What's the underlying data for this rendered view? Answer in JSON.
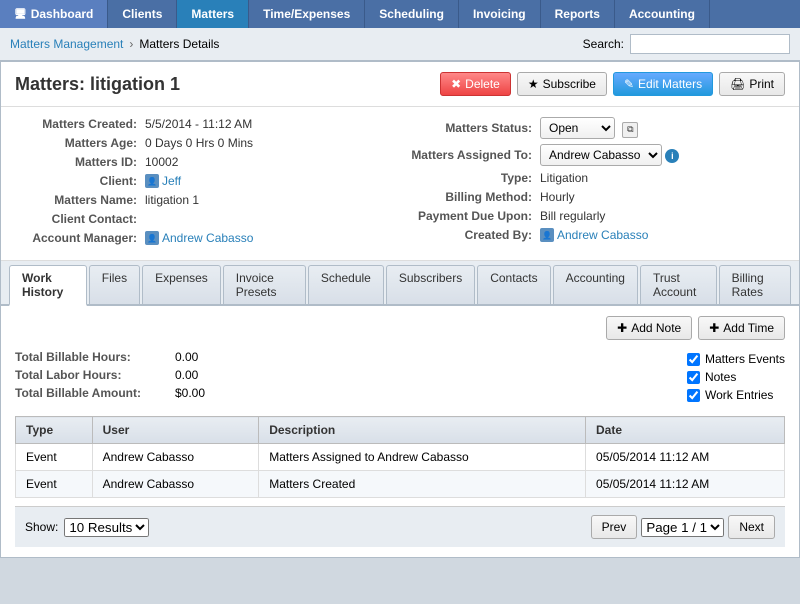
{
  "nav": {
    "items": [
      {
        "label": "Dashboard",
        "key": "dashboard",
        "active": false
      },
      {
        "label": "Clients",
        "key": "clients",
        "active": false
      },
      {
        "label": "Matters",
        "key": "matters",
        "active": true
      },
      {
        "label": "Time/Expenses",
        "key": "time",
        "active": false
      },
      {
        "label": "Scheduling",
        "key": "scheduling",
        "active": false
      },
      {
        "label": "Invoicing",
        "key": "invoicing",
        "active": false
      },
      {
        "label": "Reports",
        "key": "reports",
        "active": false
      },
      {
        "label": "Accounting",
        "key": "accounting",
        "active": false
      }
    ]
  },
  "breadcrumb": {
    "parent": "Matters Management",
    "current": "Matters Details"
  },
  "search": {
    "label": "Search:",
    "placeholder": ""
  },
  "matter": {
    "title": "Matters: litigation 1",
    "actions": {
      "delete": "Delete",
      "subscribe": "Subscribe",
      "edit": "Edit Matters",
      "print": "Print"
    },
    "fields": {
      "created_label": "Matters Created:",
      "created_value": "5/5/2014 - 11:12 AM",
      "age_label": "Matters Age:",
      "age_value": "0 Days 0 Hrs 0 Mins",
      "id_label": "Matters ID:",
      "id_value": "10002",
      "client_label": "Client:",
      "client_value": "Jeff",
      "name_label": "Matters Name:",
      "name_value": "litigation 1",
      "contact_label": "Client Contact:",
      "contact_value": "",
      "manager_label": "Account Manager:",
      "manager_value": "Andrew Cabasso",
      "status_label": "Matters Status:",
      "status_value": "Open",
      "assigned_label": "Matters Assigned To:",
      "assigned_value": "Andrew Cabasso",
      "type_label": "Type:",
      "type_value": "Litigation",
      "billing_label": "Billing Method:",
      "billing_value": "Hourly",
      "payment_label": "Payment Due Upon:",
      "payment_value": "Bill regularly",
      "created_by_label": "Created By:",
      "created_by_value": "Andrew Cabasso"
    }
  },
  "tabs": [
    {
      "label": "Work History",
      "key": "work-history",
      "active": true
    },
    {
      "label": "Files",
      "key": "files",
      "active": false
    },
    {
      "label": "Expenses",
      "key": "expenses",
      "active": false
    },
    {
      "label": "Invoice Presets",
      "key": "invoice-presets",
      "active": false
    },
    {
      "label": "Schedule",
      "key": "schedule",
      "active": false
    },
    {
      "label": "Subscribers",
      "key": "subscribers",
      "active": false
    },
    {
      "label": "Contacts",
      "key": "contacts",
      "active": false
    },
    {
      "label": "Accounting",
      "key": "accounting",
      "active": false
    },
    {
      "label": "Trust Account",
      "key": "trust-account",
      "active": false
    },
    {
      "label": "Billing Rates",
      "key": "billing-rates",
      "active": false
    }
  ],
  "tab_actions": {
    "add_note": "Add Note",
    "add_time": "Add Time"
  },
  "stats": {
    "billable_hours_label": "Total Billable Hours:",
    "billable_hours_value": "0.00",
    "labor_hours_label": "Total Labor Hours:",
    "labor_hours_value": "0.00",
    "billable_amount_label": "Total Billable Amount:",
    "billable_amount_value": "$0.00"
  },
  "checkboxes": [
    {
      "label": "Matters Events",
      "checked": true
    },
    {
      "label": "Notes",
      "checked": true
    },
    {
      "label": "Work Entries",
      "checked": true
    }
  ],
  "table": {
    "columns": [
      "Type",
      "User",
      "Description",
      "Date"
    ],
    "rows": [
      {
        "type": "Event",
        "user": "Andrew Cabasso",
        "description": "Matters Assigned to Andrew Cabasso",
        "date": "05/05/2014 11:12 AM"
      },
      {
        "type": "Event",
        "user": "Andrew Cabasso",
        "description": "Matters Created",
        "date": "05/05/2014 11:12 AM"
      }
    ]
  },
  "pagination": {
    "show_label": "Show:",
    "results_option": "10 Results",
    "prev": "Prev",
    "page_info": "Page 1 / 1",
    "next": "Next"
  }
}
